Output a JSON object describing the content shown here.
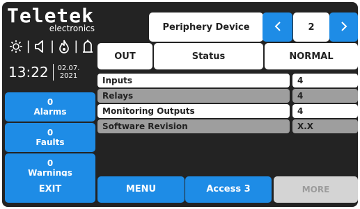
{
  "brand": {
    "name": "Teletek",
    "sub": "electronics"
  },
  "status_icons": [
    "sun-icon",
    "speaker-icon",
    "flame-icon",
    "horn-icon"
  ],
  "clock": {
    "time": "13:22",
    "date_line1": "02.07.",
    "date_line2": "2021"
  },
  "side": {
    "alarms": {
      "count": "0",
      "label": "Alarms"
    },
    "faults": {
      "count": "0",
      "label": "Faults"
    },
    "warnings": {
      "count": "0",
      "label": "Warnings"
    }
  },
  "header": {
    "title": "Periphery Device",
    "page": "2"
  },
  "status_row": {
    "type": "OUT",
    "label": "Status",
    "value": "NORMAL"
  },
  "rows": [
    {
      "label": "Inputs",
      "value": "4"
    },
    {
      "label": "Relays",
      "value": "4"
    },
    {
      "label": "Monitoring Outputs",
      "value": "4"
    },
    {
      "label": "Software Revision",
      "value": "X.X"
    }
  ],
  "footer": {
    "exit": "EXIT",
    "menu": "MENU",
    "access": "Access 3",
    "more": "MORE"
  },
  "colors": {
    "accent": "#1e8ce6",
    "background": "#232323",
    "row_alt": "#9e9e9e",
    "disabled": "#d4d4d4"
  }
}
